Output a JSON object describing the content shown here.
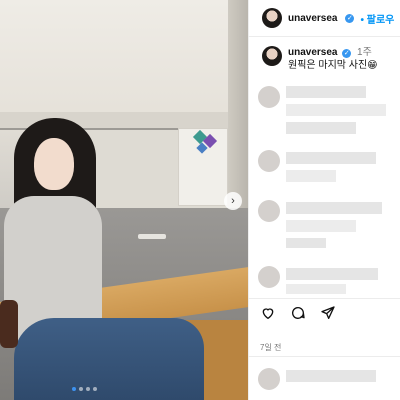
{
  "post": {
    "username": "unaversea",
    "follow_label": "• 팔로우",
    "verified_mark": "✓",
    "caption": {
      "username": "unaversea",
      "time": "1주",
      "text": "원픽은 마지막 사진😁"
    },
    "posted_ago": "7일 전"
  },
  "carousel": {
    "next_glyph": "›",
    "slide_count": 4,
    "active_slide": 1
  },
  "icons": {
    "like": "heart-icon",
    "comment": "comment-icon",
    "share": "share-icon"
  },
  "colors": {
    "accent": "#0095f6",
    "verified": "#3797f0"
  }
}
